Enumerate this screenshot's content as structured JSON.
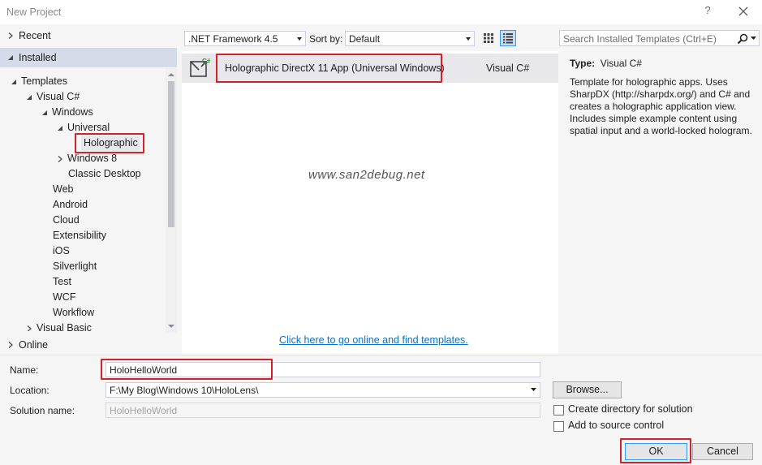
{
  "window": {
    "title": "New Project"
  },
  "sidebar": {
    "recent": "Recent",
    "installed": "Installed",
    "online": "Online",
    "tree": [
      {
        "label": "Templates"
      },
      {
        "label": "Visual C#"
      },
      {
        "label": "Windows"
      },
      {
        "label": "Universal"
      },
      {
        "label": "Holographic"
      },
      {
        "label": "Windows 8"
      },
      {
        "label": "Classic Desktop"
      },
      {
        "label": "Web"
      },
      {
        "label": "Android"
      },
      {
        "label": "Cloud"
      },
      {
        "label": "Extensibility"
      },
      {
        "label": "iOS"
      },
      {
        "label": "Silverlight"
      },
      {
        "label": "Test"
      },
      {
        "label": "WCF"
      },
      {
        "label": "Workflow"
      },
      {
        "label": "Visual Basic"
      }
    ]
  },
  "toolbar": {
    "framework": ".NET Framework 4.5",
    "sort_label": "Sort by:",
    "sort_value": "Default",
    "search_placeholder": "Search Installed Templates (Ctrl+E)"
  },
  "templates": [
    {
      "name": "Holographic DirectX 11 App (Universal Windows)",
      "language": "Visual C#",
      "icon": "csharp-holographic-icon"
    }
  ],
  "watermark": "www.san2debug.net",
  "online_link": "Click here to go online and find templates.",
  "details": {
    "type_label": "Type:",
    "type_value": "Visual C#",
    "description": "Template for holographic apps. Uses SharpDX (http://sharpdx.org/) and C# and creates a holographic application view. Includes simple example content using spatial input and a world-locked hologram."
  },
  "form": {
    "name_label": "Name:",
    "name_value": "HoloHelloWorld",
    "location_label": "Location:",
    "location_value": "F:\\My Blog\\Windows 10\\HoloLens\\",
    "solution_label": "Solution name:",
    "solution_value": "HoloHelloWorld",
    "browse": "Browse...",
    "create_dir": "Create directory for solution",
    "add_source": "Add to source control",
    "ok": "OK",
    "cancel": "Cancel"
  },
  "colors": {
    "highlight": "#d9202a",
    "link": "#0e70c0",
    "selection": "#d6dbe9"
  }
}
